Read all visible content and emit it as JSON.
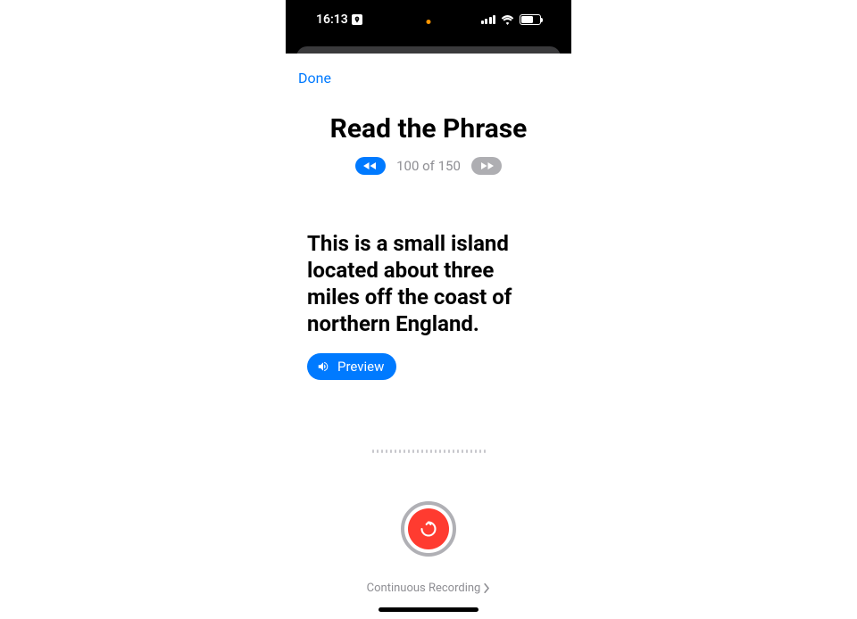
{
  "status": {
    "time": "16:13"
  },
  "sheet": {
    "doneLabel": "Done",
    "title": "Read the Phrase",
    "counter": "100 of 150",
    "phrase": "This is a small island located about three miles off the coast of northern England.",
    "previewLabel": "Preview",
    "continuousLabel": "Continuous Recording"
  },
  "colors": {
    "accent": "#007aff",
    "record": "#ff3b30",
    "muted": "#8e8e93"
  }
}
